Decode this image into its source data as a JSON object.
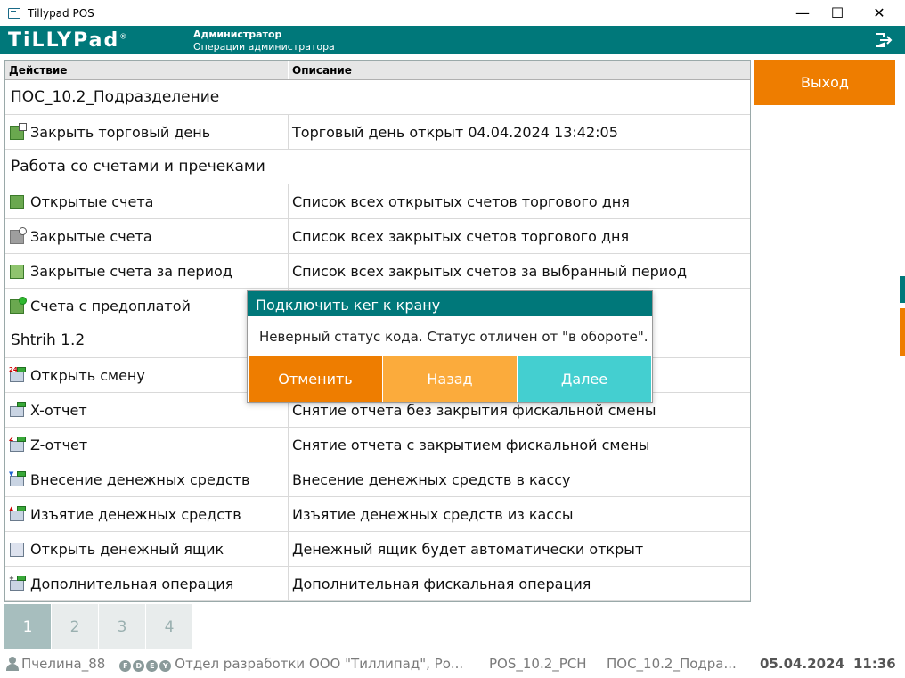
{
  "window": {
    "title": "Tillypad POS",
    "minimize": "—",
    "maximize": "☐",
    "close": "✕"
  },
  "header": {
    "logo": "TiLLYPad",
    "logo_mark": "®",
    "role": "Администратор",
    "operations": "Операции администратора"
  },
  "table": {
    "col_action": "Действие",
    "col_description": "Описание",
    "groups": {
      "pos": "ПОС_10.2_Подразделение",
      "checks": "Работа со счетами и пречеками",
      "shtrih": "Shtrih 1.2"
    },
    "rows": [
      {
        "action": "Закрыть торговый день",
        "description": "Торговый день открыт 04.04.2024 13:42:05"
      },
      {
        "action": "Открытые счета",
        "description": "Список всех открытых счетов торгового дня"
      },
      {
        "action": "Закрытые счета",
        "description": "Список всех закрытых счетов торгового дня"
      },
      {
        "action": "Закрытые счета за период",
        "description": "Список всех закрытых счетов за выбранный период"
      },
      {
        "action": "Счета с предоплатой",
        "description": ""
      },
      {
        "action": "Открыть смену",
        "description": ""
      },
      {
        "action": "X-отчет",
        "description": "Снятие отчета без закрытия фискальной смены"
      },
      {
        "action": "Z-отчет",
        "description": "Снятие отчета с закрытием фискальной смены"
      },
      {
        "action": "Внесение денежных средств",
        "description": "Внесение денежных средств в кассу"
      },
      {
        "action": "Изъятие денежных средств",
        "description": "Изъятие денежных средств из кассы"
      },
      {
        "action": "Открыть денежный ящик",
        "description": "Денежный ящик будет автоматически открыт"
      },
      {
        "action": "Дополнительная операция",
        "description": "Дополнительная фискальная операция"
      }
    ]
  },
  "side": {
    "exit_label": "Выход"
  },
  "pager": {
    "pages": [
      "1",
      "2",
      "3",
      "4"
    ],
    "active": "1"
  },
  "status": {
    "user": "Пчелина_88",
    "flags": [
      "F",
      "D",
      "E",
      "Y"
    ],
    "org": "Отдел разработки ООО \"Тиллипад\", Ро...",
    "terminal": "POS_10.2_РСН",
    "division": "ПОС_10.2_Подра...",
    "date": "05.04.2024",
    "time": "11:36"
  },
  "dialog": {
    "title": "Подключить кег к крану",
    "message": "Неверный статус кода. Статус отличен от \"в обороте\".",
    "cancel": "Отменить",
    "back": "Назад",
    "next": "Далее"
  },
  "colors": {
    "teal": "#00787a",
    "orange": "#ee7d00",
    "light_orange": "#fbab3c",
    "cyan": "#44cfd0"
  }
}
